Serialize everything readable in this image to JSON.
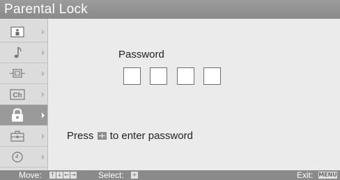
{
  "window": {
    "title": "Parental Lock"
  },
  "sidebar": {
    "items": [
      {
        "icon": "picture-icon",
        "active": false
      },
      {
        "icon": "music-note-icon",
        "active": false
      },
      {
        "icon": "screen-adjust-icon",
        "active": false
      },
      {
        "icon": "channel-icon",
        "active": false,
        "label": "Ch"
      },
      {
        "icon": "lock-icon",
        "active": true
      },
      {
        "icon": "toolbox-icon",
        "active": false
      },
      {
        "icon": "clock-icon",
        "active": false
      }
    ]
  },
  "main": {
    "password_label": "Password",
    "digit_count": 4,
    "instruction_prefix": "Press",
    "instruction_suffix": "to enter password"
  },
  "status": {
    "move_label": "Move:",
    "move_keys": [
      "↑",
      "↓",
      "←",
      "→"
    ],
    "select_label": "Select:",
    "exit_label": "Exit:",
    "exit_key": "MENU"
  },
  "colors": {
    "title_bar": "#8f8f8f",
    "status_bar": "#8a8a8a",
    "active_item": "#9a9a9a",
    "background": "#ebebeb"
  }
}
